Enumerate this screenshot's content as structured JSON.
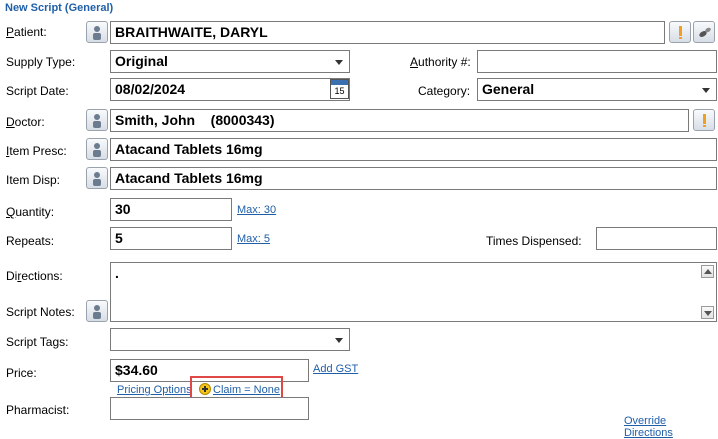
{
  "window": {
    "title": "New Script (General)"
  },
  "labels": {
    "patient": "Patient:",
    "supply_type": "Supply Type:",
    "authority": "Authority #:",
    "script_date": "Script Date:",
    "category": "Category:",
    "doctor": "Doctor:",
    "item_presc": "Item Presc:",
    "item_disp": "Item Disp:",
    "quantity": "Quantity:",
    "repeats": "Repeats:",
    "times_dispensed": "Times Dispensed:",
    "directions": "Directions:",
    "script_notes": "Script Notes:",
    "script_tags": "Script Tags:",
    "price": "Price:",
    "pharmacist": "Pharmacist:"
  },
  "fields": {
    "patient": "BRAITHWAITE, DARYL",
    "supply_type": "Original",
    "authority": "",
    "script_date": "08/02/2024",
    "calendar_day": "15",
    "category": "General",
    "doctor": "Smith, John    (8000343)",
    "item_presc": "Atacand Tablets 16mg",
    "item_disp": "Atacand Tablets 16mg",
    "quantity": "30",
    "repeats": "5",
    "times_dispensed": "",
    "directions": ".",
    "script_tags": "",
    "price": "$34.60",
    "pharmacist": ""
  },
  "links": {
    "max_qty": "Max: 30",
    "max_repeats": "Max: 5",
    "add_gst": "Add GST",
    "pricing_options": "Pricing Options",
    "claim": "Claim = None",
    "override_directions": "Override Directions"
  },
  "colors": {
    "accent": "#1f5fa8",
    "highlight": "#e04848",
    "warning": "#f0a020"
  }
}
